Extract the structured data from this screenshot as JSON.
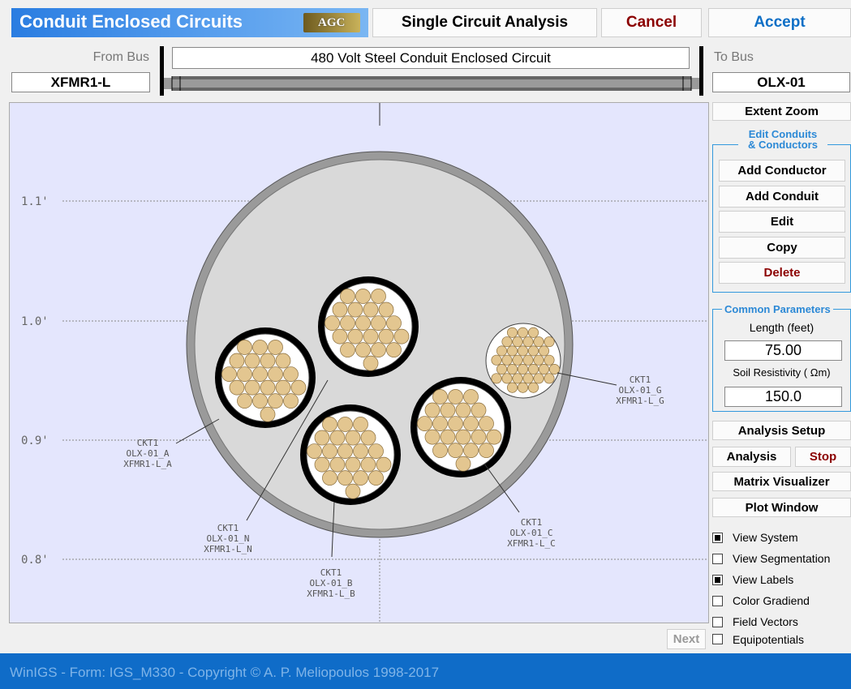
{
  "header": {
    "title": "Conduit Enclosed Circuits",
    "logo_text": "AGC",
    "analysis_label": "Single Circuit Analysis",
    "cancel_label": "Cancel",
    "accept_label": "Accept"
  },
  "circuit": {
    "from_bus_label": "From Bus",
    "from_bus_value": "XFMR1-L",
    "description": "480 Volt Steel Conduit Enclosed Circuit",
    "to_bus_label": "To Bus",
    "to_bus_value": "OLX-01"
  },
  "canvas": {
    "y_ticks": [
      "1.1'",
      "1.0'",
      "0.9'",
      "0.8'"
    ],
    "labels": [
      {
        "lines": [
          "CKT1",
          "OLX-01_A",
          "XFMR1-L_A"
        ]
      },
      {
        "lines": [
          "CKT1",
          "OLX-01_N",
          "XFMR1-L_N"
        ]
      },
      {
        "lines": [
          "CKT1",
          "OLX-01_B",
          "XFMR1-L_B"
        ]
      },
      {
        "lines": [
          "CKT1",
          "OLX-01_C",
          "XFMR1-L_C"
        ]
      },
      {
        "lines": [
          "CKT1",
          "OLX-01_G",
          "XFMR1-L_G"
        ]
      }
    ],
    "colors": {
      "background": "#e4e6fd",
      "conduit_fill": "#d9d9d9",
      "strand": "#e3c690",
      "insulation": "#000000"
    }
  },
  "sidebar": {
    "extent_zoom": "Extent Zoom",
    "edit_group_title_1": "Edit Conduits",
    "edit_group_title_2": "& Conductors",
    "add_conductor": "Add Conductor",
    "add_conduit": "Add Conduit",
    "edit": "Edit",
    "copy": "Copy",
    "delete": "Delete",
    "common_title": "Common Parameters",
    "length_label": "Length (feet)",
    "length_value": "75.00",
    "soil_label": "Soil Resistivity ( Ωm)",
    "soil_value": "150.0",
    "analysis_setup": "Analysis Setup",
    "analysis": "Analysis",
    "stop": "Stop",
    "matrix_visualizer": "Matrix Visualizer",
    "plot_window": "Plot Window",
    "checkboxes": [
      {
        "label": "View System",
        "checked": true
      },
      {
        "label": "View Segmentation",
        "checked": false
      },
      {
        "label": "View Labels",
        "checked": true
      },
      {
        "label": "Color Gradiend",
        "checked": false
      },
      {
        "label": "Field Vectors",
        "checked": false
      },
      {
        "label": "Equipotentials",
        "checked": false
      }
    ]
  },
  "next_label": "Next",
  "footer": "WinIGS - Form: IGS_M330 - Copyright © A. P. Meliopoulos 1998-2017"
}
